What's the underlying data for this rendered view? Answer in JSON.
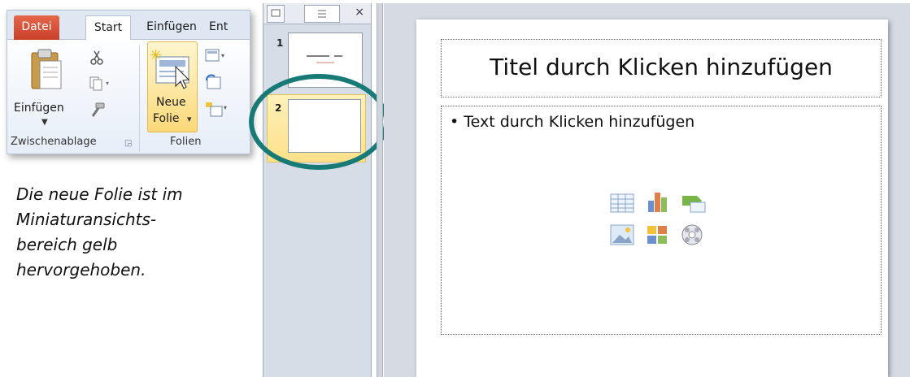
{
  "ribbon": {
    "tabs": [
      "Datei",
      "Start",
      "Einfügen",
      "Ent"
    ],
    "paste_label": "Einfügen",
    "new_slide_line1": "Neue",
    "new_slide_line2": "Folie",
    "new_slide_arrow": "▾",
    "group_clipboard": "Zwischenablage",
    "group_slides": "Folien"
  },
  "caption": {
    "line1": "Die neue Folie ist im",
    "line2": "Miniaturansichts-",
    "line3": "bereich gelb",
    "line4": "hervorgehoben."
  },
  "pane": {
    "close": "×",
    "thumbs": [
      {
        "number": "1",
        "selected": false
      },
      {
        "number": "2",
        "selected": true
      }
    ]
  },
  "slide": {
    "title_placeholder": "Titel durch Klicken hinzufügen",
    "body_placeholder": "• Text durch Klicken hinzufügen"
  },
  "colors": {
    "datei_tab": "#d5533a",
    "highlight": "#fde08a",
    "marker": "#177a76"
  }
}
